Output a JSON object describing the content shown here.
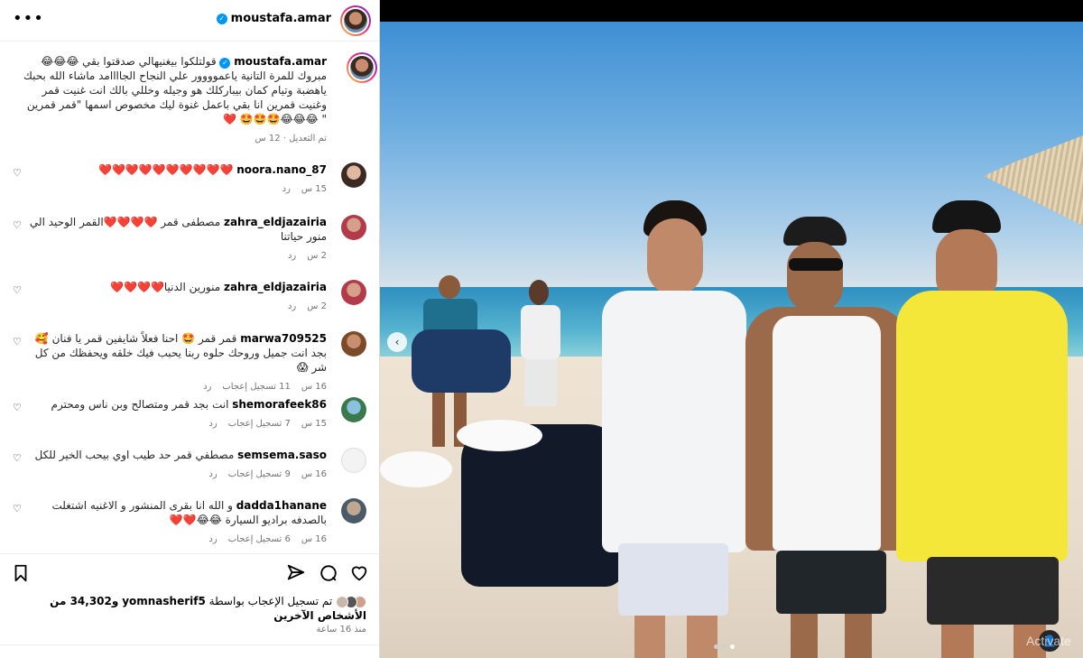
{
  "header": {
    "username": "moustafa.amar"
  },
  "caption": {
    "username": "moustafa.amar",
    "text": "قولتلكوا بيغنيهالي صدقتوا بقي 😂😂😂 مبروك للمرة التانية ياعموووور علي النجاح الجاااامد ماشاء الله بحبك ياهضبة وتيام كمان بيباركلك هو وجيله وخللي بالك انت غنيت قمر وغنيت قمرين انا بقي باعمل غنوة ليك مخصوص اسمها \"قمر قمرين \" 😂😂😂🤩🤩🤩 ❤️",
    "meta": "تم التعديل · 12 س"
  },
  "comments": [
    {
      "username": "noora.nano_87",
      "text": "❤️❤️❤️❤️❤️❤️❤️❤️❤️❤️",
      "time": "15 س",
      "likes": "",
      "reply": "رد"
    },
    {
      "username": "zahra_eldjazairia",
      "text": "مصطفى قمر ❤️❤️❤️❤️القمر الوحيد الي منور حياتنا",
      "time": "2 س",
      "likes": "",
      "reply": "رد"
    },
    {
      "username": "zahra_eldjazairia",
      "text": "منورين الدنيا❤️❤️❤️❤️",
      "time": "2 س",
      "likes": "",
      "reply": "رد"
    },
    {
      "username": "marwa709525",
      "text": "قمر قمر 🤩 احنا فعلاً شايفين قمر يا فنان 🥰 بجد انت جميل وروحك حلوه ربنا يحبب فيك خلقه ويحفظك من كل شر 😱",
      "time": "16 س",
      "likes": "11 تسجيل إعجاب",
      "reply": "رد"
    },
    {
      "username": "shemorafeek86",
      "text": "انت بجد قمر ومتصالح وبن ناس ومحترم",
      "time": "15 س",
      "likes": "7 تسجيل إعجاب",
      "reply": "رد"
    },
    {
      "username": "semsema.saso",
      "text": "مصطفي قمر حد طيب اوي بيحب الخير للكل",
      "time": "16 س",
      "likes": "9 تسجيل إعجاب",
      "reply": "رد"
    },
    {
      "username": "dadda1hanane",
      "text": "و الله انا بقرى المنشور و الاغنيه اشتغلت بالصدفه براديو السيارة 😂😂❤️❤️",
      "time": "16 س",
      "likes": "6 تسجيل إعجاب",
      "reply": "رد"
    }
  ],
  "likes": {
    "prefix": "تم تسجيل الإعجاب بواسطة",
    "user": "yomnasherif5",
    "rest": "و34,302 من الأشخاص الآخرين"
  },
  "posted": "منذ 16 ساعة",
  "watermark": "Activate"
}
